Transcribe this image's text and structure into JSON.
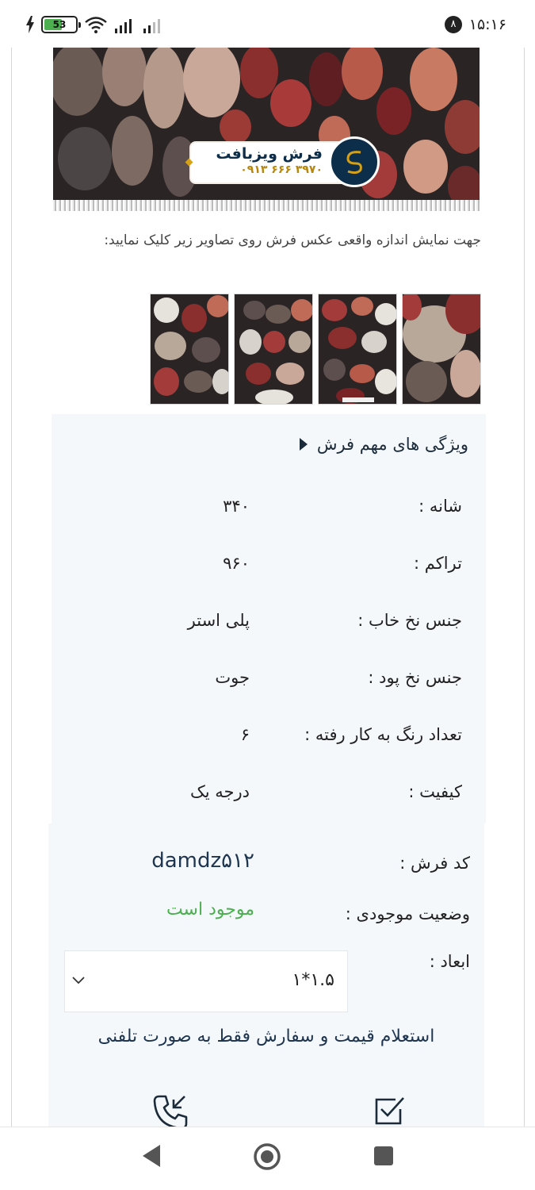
{
  "status_bar": {
    "time": "۱۵:۱۶",
    "notification_count": "۸",
    "battery": "53",
    "battery_level": 0.53
  },
  "banner": {
    "logo_name": "فرش ویزبافت",
    "logo_phone": "۰۹۱۳ ۶۶۶ ۳۹۷۰"
  },
  "hint": "جهت نمایش اندازه واقعی عکس فرش روی تصاویر زیر کلیک نمایید:",
  "features": {
    "title": "ویژگی های مهم فرش",
    "rows": [
      {
        "label": "شانه :",
        "value": "۳۴۰"
      },
      {
        "label": "تراکم :",
        "value": "۹۶۰"
      },
      {
        "label": "جنس نخ خاب :",
        "value": "پلی استر"
      },
      {
        "label": "جنس نخ پود :",
        "value": "جوت"
      },
      {
        "label": "تعداد رنگ به کار رفته :",
        "value": "۶"
      },
      {
        "label": "کیفیت :",
        "value": "درجه یک"
      }
    ]
  },
  "order": {
    "code_label": "کد فرش :",
    "code_value": "damdz۵۱۲",
    "stock_label": "وضعیت موجودی :",
    "stock_value": "موجود است",
    "dimensions_label": "ابعاد :",
    "dimensions_value": "۱*۱.۵",
    "note": "استعلام قیمت و سفارش فقط به صورت تلفنی"
  },
  "colors": {
    "accent_dark": "#1e3550",
    "in_stock": "#4caf50",
    "panel_bg": "#f4f8fb"
  },
  "icons": [
    "charging-icon",
    "battery-icon",
    "wifi-icon",
    "signal-icon",
    "notification-badge",
    "caret-left-icon",
    "chevron-down-icon",
    "phone-call-icon",
    "checkbox-icon",
    "back-icon",
    "home-icon",
    "recents-icon"
  ]
}
